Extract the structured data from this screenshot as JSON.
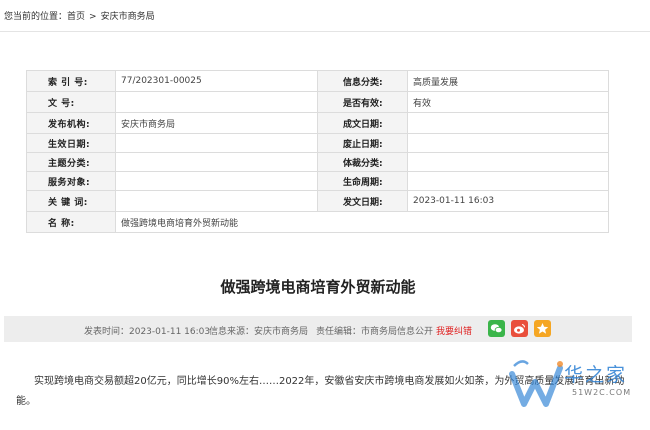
{
  "breadcrumb": {
    "prefix": "您当前的位置：",
    "home": "首页",
    "separator": ">",
    "current": "安庆市商务局"
  },
  "meta": {
    "rows": [
      {
        "k1": "索 引 号:",
        "v1": "77/202301-00025",
        "k2": "信息分类:",
        "v2": "高质量发展"
      },
      {
        "k1": "文      号:",
        "v1": "",
        "k2": "是否有效:",
        "v2": "有效"
      },
      {
        "k1": "发布机构:",
        "v1": "安庆市商务局",
        "k2": "成文日期:",
        "v2": ""
      },
      {
        "k1": "生效日期:",
        "v1": "",
        "k2": "废止日期:",
        "v2": ""
      },
      {
        "k1": "主题分类:",
        "v1": "",
        "k2": "体裁分类:",
        "v2": ""
      },
      {
        "k1": "服务对象:",
        "v1": "",
        "k2": "生命周期:",
        "v2": ""
      },
      {
        "k1": "关 键 词:",
        "v1": "",
        "k2": "发文日期:",
        "v2": "2023-01-11 16:03"
      }
    ],
    "name_label": "名      称:",
    "name_value": "做强跨境电商培育外贸新动能"
  },
  "article": {
    "title": "做强跨境电商培育外贸新动能",
    "publish_time": "发表时间：2023-01-11 16:03",
    "source": "信息来源：安庆市商务局",
    "editor": "责任编辑：市商务局信息公开",
    "report_error": "我要纠错",
    "share_colors": {
      "wechat": "#3bb54a",
      "weibo": "#e94f3c",
      "favorite": "#f5a623"
    },
    "share_icons": [
      "wechat-icon",
      "weibo-icon",
      "favorite-icon"
    ],
    "body": "实现跨境电商交易额超20亿元，同比增长90%左右……2022年，安徽省安庆市跨境电商发展如火如荼，为外贸高质量发展培育出新动能。"
  },
  "watermark": {
    "text": "华之家",
    "domain": "51W2C.COM",
    "color": "#2a7fd4"
  }
}
